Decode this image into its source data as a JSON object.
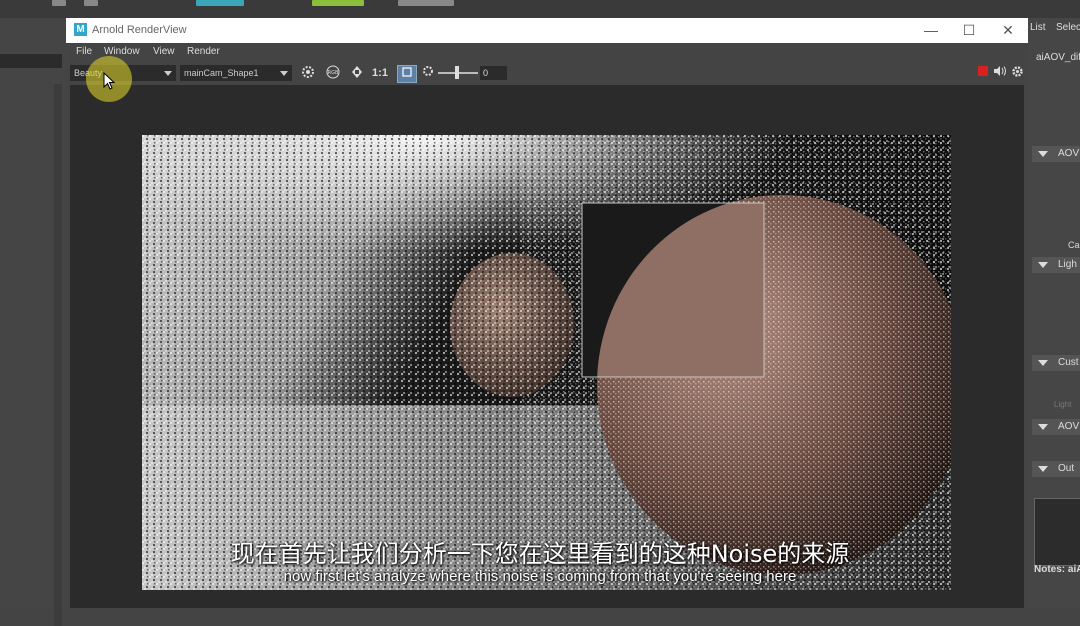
{
  "window": {
    "title": "Arnold RenderView",
    "logo_letter": "M",
    "controls": {
      "minimize": "—",
      "maximize": "☐",
      "close": "✕"
    }
  },
  "menu": [
    "File",
    "Window",
    "View",
    "Render"
  ],
  "toolbar": {
    "aov_select": "Beauty",
    "camera_select": "mainCam_Shape1",
    "ratio_label": "1:1",
    "exposure_value": "0",
    "icons": [
      "refresh-icon",
      "rgb-icon",
      "channel-icon",
      "crop-region-icon",
      "settings-icon",
      "stop-icon",
      "speaker-icon",
      "gear-icon"
    ]
  },
  "right_panel": {
    "top_tabs": [
      "List",
      "Selec"
    ],
    "node_label": "aiAOV_dif",
    "sections": [
      "AOV",
      "Ligh",
      "Cust",
      "AOV",
      "Out"
    ],
    "labels": {
      "ca": "Ca",
      "light_faded": "Light",
      "notes": "Notes: aiA"
    }
  },
  "subtitles": {
    "zh": "现在首先让我们分析一下您在这里看到的这种Noise的来源",
    "en": "now first let's analyze where this noise is coming from that you're seeing here"
  },
  "colors": {
    "accent_blue": "#30a7c9",
    "stop_red": "#d92020",
    "cursor_highlight": "#e6dc28"
  }
}
